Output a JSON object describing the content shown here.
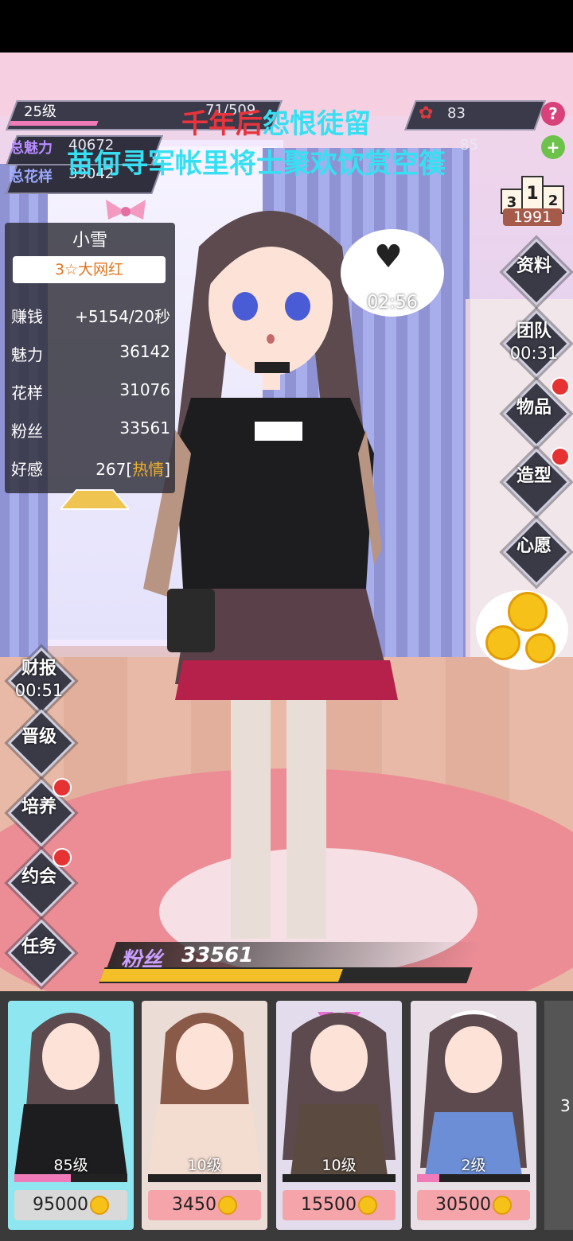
{
  "header": {
    "level": "25级",
    "exp_text": "71/509",
    "charm_label": "总魅力",
    "charm_value": "40672",
    "style_label": "总花样",
    "style_value": "39042",
    "rose_count": "83",
    "gem_count": "85",
    "help_icon": "?",
    "add_icon": "+",
    "overlay_line1_red": "千年后",
    "overlay_line1_cyan": "怨恨徒留",
    "overlay_line2": "苗何寻军帐里将士聚欢饮赏空篌"
  },
  "rank": {
    "podium": [
      "3",
      "1",
      "2"
    ],
    "value": "1991"
  },
  "profile": {
    "name": "小雪",
    "title": "3☆大网红",
    "stats": [
      {
        "label": "赚钱",
        "value": "+5154/20秒"
      },
      {
        "label": "魅力",
        "value": "36142"
      },
      {
        "label": "花样",
        "value": "31076"
      },
      {
        "label": "粉丝",
        "value": "33561"
      }
    ],
    "favor_label": "好感",
    "favor_value": "267",
    "favor_open": "[",
    "favor_state": "热情",
    "favor_close": "]"
  },
  "bubble_timer": "02:56",
  "right_menu": {
    "info": "资料",
    "team": "团队",
    "team_timer": "00:31",
    "items": "物品",
    "style": "造型",
    "wish": "心愿"
  },
  "left_menu": {
    "report": "财报",
    "report_timer": "00:51",
    "promote": "晋级",
    "train": "培养",
    "date": "约会",
    "task": "任务"
  },
  "fans": {
    "label": "粉丝",
    "value": "33561",
    "progress": 0.65
  },
  "cards": [
    {
      "level": "85级",
      "price": "95000",
      "xp": 0.5,
      "selected": true
    },
    {
      "level": "10级",
      "price": "3450",
      "xp": 0,
      "selected": false
    },
    {
      "level": "10级",
      "price": "15500",
      "xp": 0,
      "selected": false
    },
    {
      "level": "2级",
      "price": "30500",
      "xp": 0.2,
      "selected": false
    }
  ],
  "more_card_hint": "3",
  "colors": {
    "accent_pink": "#f07bb8",
    "coin_gold": "#f6c21a",
    "alert_red": "#e63232",
    "overlay_red": "#e8343c",
    "overlay_cyan": "#36e0f2"
  }
}
